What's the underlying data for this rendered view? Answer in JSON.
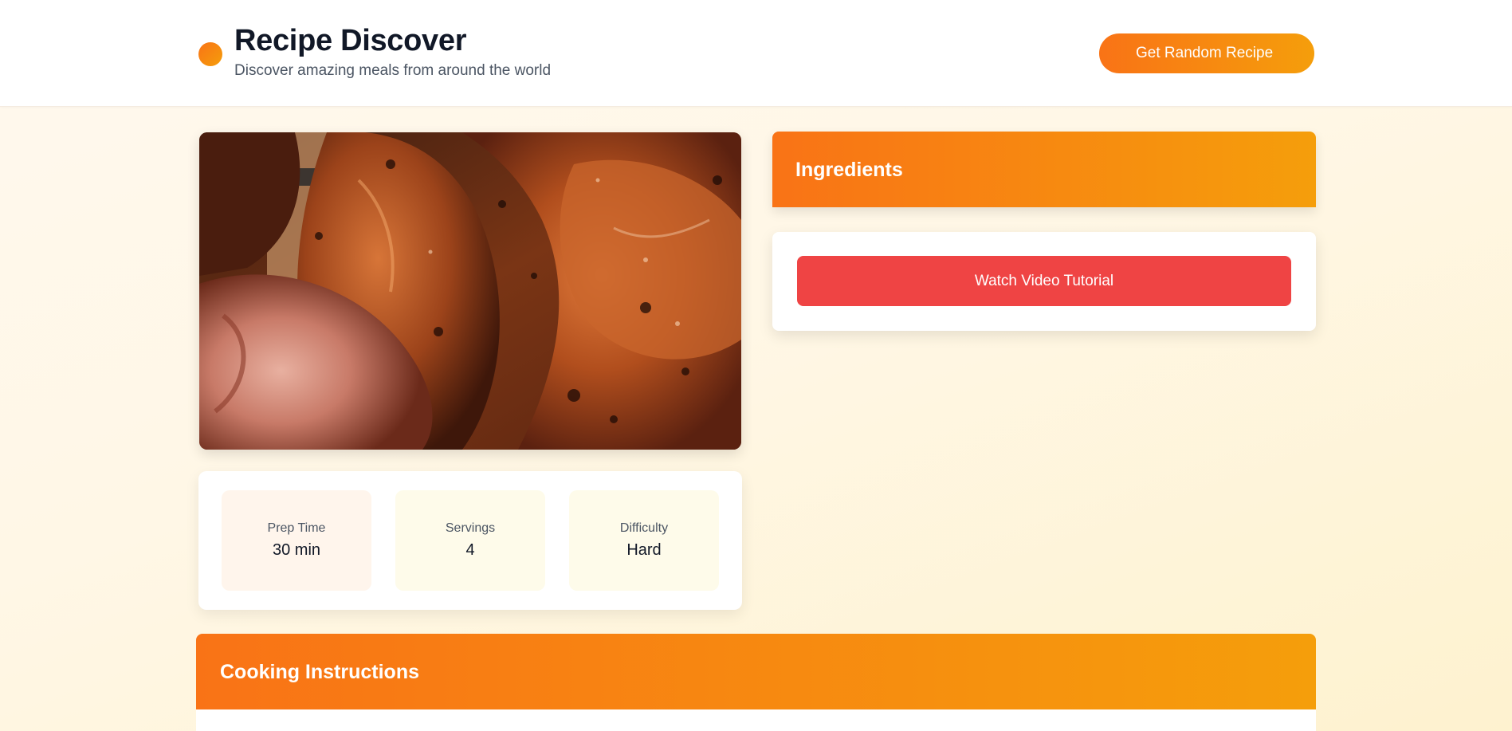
{
  "header": {
    "title": "Recipe Discover",
    "subtitle": "Discover amazing meals from around the world",
    "random_button_label": "Get Random Recipe"
  },
  "recipe": {
    "image_alt": "",
    "stats": [
      {
        "label": "Prep Time",
        "value": "30 min"
      },
      {
        "label": "Servings",
        "value": "4"
      },
      {
        "label": "Difficulty",
        "value": "Hard"
      }
    ]
  },
  "ingredients": {
    "title": "Ingredients",
    "video_button_label": "Watch Video Tutorial"
  },
  "instructions": {
    "title": "Cooking Instructions"
  },
  "colors": {
    "accent_start": "#f97316",
    "accent_end": "#f59e0b",
    "video_button": "#ef4444",
    "text_dark": "#111827",
    "text_muted": "#4b5563"
  }
}
